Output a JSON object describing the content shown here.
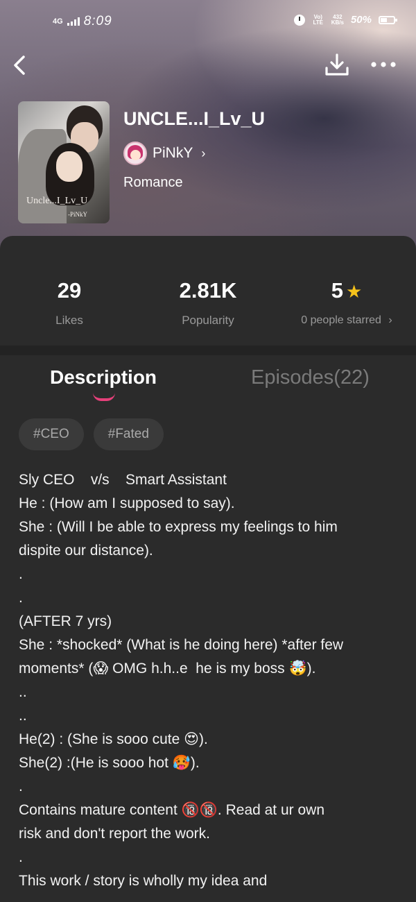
{
  "status_bar": {
    "network": "4G",
    "time": "8:09",
    "volte": "Vo) LTE",
    "speed_value": "432",
    "speed_unit": "KB/s",
    "battery": "50%"
  },
  "nav": {
    "back_icon": "chevron-left-icon",
    "download_icon": "download-icon",
    "more_icon": "more-dots-icon"
  },
  "book": {
    "cover_title": "Uncle...I_Lv_U",
    "cover_author": "-PiNkY",
    "title": "UNCLE...I_Lv_U",
    "author": "PiNkY",
    "genre": "Romance"
  },
  "stats": [
    {
      "value": "29",
      "label": "Likes"
    },
    {
      "value": "2.81K",
      "label": "Popularity"
    },
    {
      "value": "5",
      "label": "0 people starred"
    }
  ],
  "tabs": {
    "description": "Description",
    "episodes": "Episodes(22)"
  },
  "tags": [
    "#CEO",
    "#Fated"
  ],
  "description_lines": [
    "Sly CEO    v/s    Smart Assistant",
    "He : (How am I supposed to say).",
    "She : (Will I be able to express my feelings to him",
    "dispite our distance).",
    ".",
    ".",
    "(AFTER 7 yrs)",
    "She : *shocked* (What is he doing here) *after few",
    "moments* (😱 OMG h.h..e  he is my boss 🤯).",
    "..",
    "..",
    "He(2) : (She is sooo cute 😍).",
    "She(2) :(He is sooo hot 🥵).",
    ".",
    "Contains mature content 🔞🔞. Read at ur own",
    "risk and don't report the work.",
    ".",
    "This work / story is wholly my idea and"
  ],
  "colors": {
    "background": "#2b2b2b",
    "accent_pink": "#e6407a",
    "star_yellow": "#f5c21b",
    "muted_text": "#9a9a9a"
  }
}
